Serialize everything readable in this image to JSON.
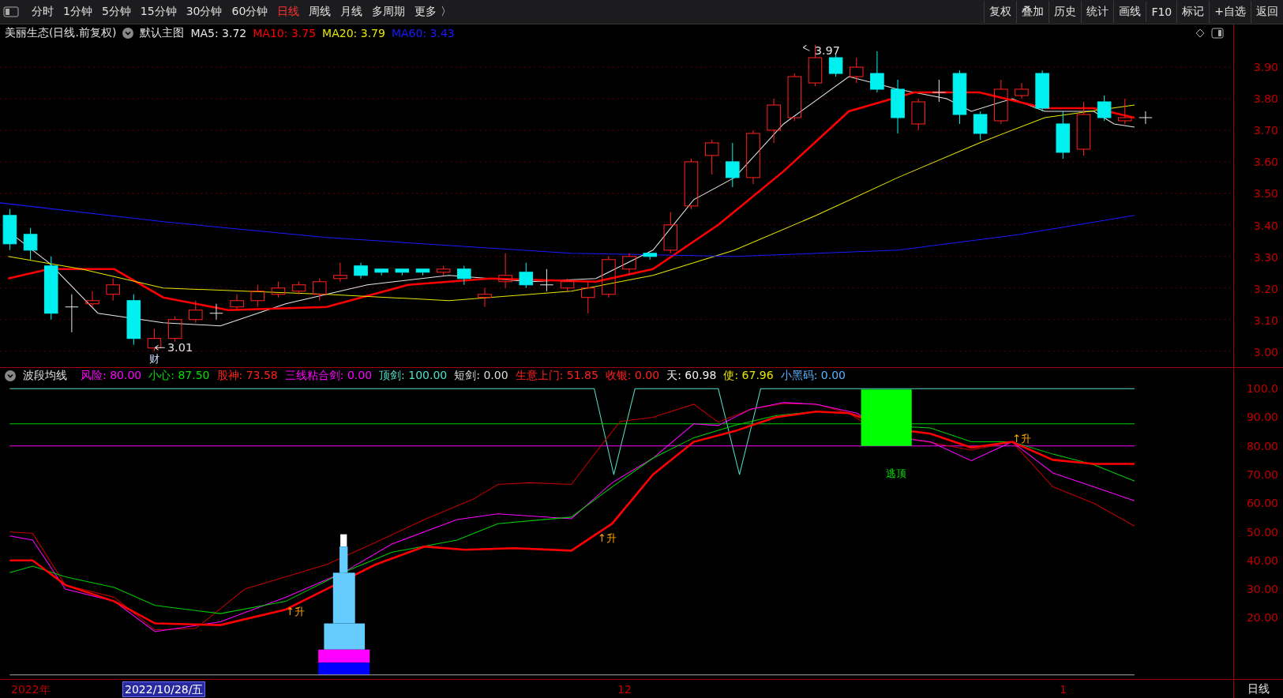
{
  "toolbar": {
    "periods": [
      {
        "label": "分时",
        "selected": false
      },
      {
        "label": "1分钟",
        "selected": false
      },
      {
        "label": "5分钟",
        "selected": false
      },
      {
        "label": "15分钟",
        "selected": false
      },
      {
        "label": "30分钟",
        "selected": false
      },
      {
        "label": "60分钟",
        "selected": false
      },
      {
        "label": "日线",
        "selected": true
      },
      {
        "label": "周线",
        "selected": false
      },
      {
        "label": "月线",
        "selected": false
      },
      {
        "label": "多周期",
        "selected": false
      },
      {
        "label": "更多 〉",
        "selected": false
      }
    ],
    "tools": [
      "复权",
      "叠加",
      "历史",
      "统计",
      "画线",
      "F10",
      "标记",
      "+自选",
      "返回"
    ]
  },
  "main_panel": {
    "stock_title": "美丽生态(日线.前复权)",
    "template": "默认主图",
    "moving_averages": [
      {
        "label": "MA5: 3.72",
        "color": "#e6e6e6"
      },
      {
        "label": "MA10: 3.75",
        "color": "#ff0000"
      },
      {
        "label": "MA20: 3.79",
        "color": "#e6e600"
      },
      {
        "label": "MA60: 3.43",
        "color": "#1a1aff"
      }
    ],
    "annotations": [
      {
        "kind": "high",
        "text": "3.97"
      },
      {
        "kind": "low",
        "text": "3.01"
      },
      {
        "kind": "marker",
        "text": "财"
      }
    ],
    "price_axis": [
      "3.90",
      "3.80",
      "3.70",
      "3.60",
      "3.50",
      "3.40",
      "3.30",
      "3.20",
      "3.10",
      "3.00"
    ]
  },
  "indicator_panel": {
    "name": "波段均线",
    "values": [
      {
        "label": "风险: 80.00",
        "color": "#ff00ff"
      },
      {
        "label": "小心: 87.50",
        "color": "#00e000"
      },
      {
        "label": "股神: 73.58",
        "color": "#ff2020"
      },
      {
        "label": "三线粘合剑: 0.00",
        "color": "#ff00ff"
      },
      {
        "label": "顶剑: 100.00",
        "color": "#4fe0c8"
      },
      {
        "label": "短剑: 0.00",
        "color": "#dcdcdc"
      },
      {
        "label": "生意上门: 51.85",
        "color": "#ff2020"
      },
      {
        "label": "收银: 0.00",
        "color": "#ff2020"
      },
      {
        "label": "天: 60.98",
        "color": "#f0f0f0"
      },
      {
        "label": "使: 67.96",
        "color": "#e6e600"
      },
      {
        "label": "小黑码: 0.00",
        "color": "#5ab4ff"
      }
    ],
    "signals": [
      {
        "kind": "rise",
        "text": "↑升"
      },
      {
        "kind": "rise",
        "text": "↑升"
      },
      {
        "kind": "rise",
        "text": "↑升"
      },
      {
        "kind": "escape",
        "text": "逃顶"
      }
    ],
    "axis": [
      "100.0",
      "90.00",
      "80.00",
      "70.00",
      "60.00",
      "50.00",
      "40.00",
      "30.00",
      "20.00"
    ]
  },
  "time_axis": {
    "labels": [
      {
        "text": "2022年",
        "selected": false
      },
      {
        "text": "2022/10/28/五",
        "selected": true
      },
      {
        "text": "12",
        "selected": false
      },
      {
        "text": "1",
        "selected": false
      }
    ],
    "period": "日线"
  }
}
